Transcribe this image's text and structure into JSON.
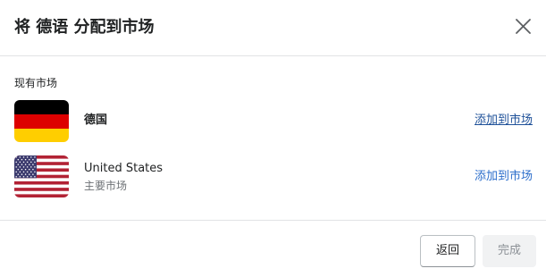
{
  "dialog": {
    "title": "将 德语 分配到市场",
    "close_icon": "close-icon"
  },
  "section": {
    "label": "现有市场"
  },
  "markets": [
    {
      "name": "德国",
      "subtitle": "",
      "flag_icon": "germany-flag-icon",
      "action_label": "添加到市场",
      "action_state": "hover"
    },
    {
      "name": "United States",
      "subtitle": "主要市场",
      "flag_icon": "united-states-flag-icon",
      "action_label": "添加到市场",
      "action_state": "default"
    }
  ],
  "footer": {
    "back_label": "返回",
    "done_label": "完成",
    "done_disabled": true
  },
  "colors": {
    "link": "#2c6ecb",
    "link_hover": "#1f5199",
    "text": "#202223",
    "subdued_text": "#6d7175",
    "divider": "#e1e3e5",
    "disabled_bg": "#f1f2f3"
  }
}
